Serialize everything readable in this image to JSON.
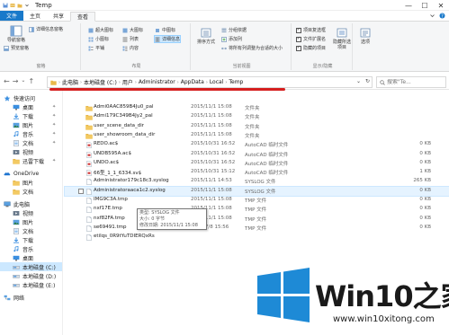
{
  "window": {
    "title": "Temp",
    "controls": {
      "minimize": "—",
      "maximize": "☐",
      "close": "✕"
    }
  },
  "tabs": [
    {
      "label": "文件"
    },
    {
      "label": "主页"
    },
    {
      "label": "共享"
    },
    {
      "label": "查看"
    }
  ],
  "tab_right_icons": [
    "chevron-down-icon",
    "help-icon"
  ],
  "ribbon": {
    "pane": {
      "nav_pane": "导航窗格",
      "preview_pane": "预览窗格",
      "details_pane": "详细信息窗格",
      "group_label": "窗格"
    },
    "layout": {
      "items": [
        "超大图标",
        "大图标",
        "中图标",
        "小图标",
        "列表",
        "详细信息",
        "平铺",
        "内容"
      ],
      "selected": "详细信息",
      "group_label": "布局"
    },
    "current_view": {
      "sort_by": "排序方式",
      "group_by": "分组依据",
      "add_columns": "添加列",
      "size_all_columns": "将所有列调整为合适的大小",
      "group_label": "当前视图"
    },
    "show_hide": {
      "item_checkboxes": {
        "label": "项目复选框",
        "checked": true
      },
      "file_extensions": {
        "label": "文件扩展名",
        "checked": true
      },
      "hidden_items": {
        "label": "隐藏的项目",
        "checked": true
      },
      "hide_selected": "隐藏所选项目",
      "group_label": "显示/隐藏"
    },
    "options": {
      "label": "选项"
    }
  },
  "address": {
    "back": "←",
    "forward": "→",
    "recent": "⌄",
    "up": "↑",
    "crumbs": [
      "此电脑",
      "本地磁盘 (C:)",
      "用户",
      "Administrator",
      "AppData",
      "Local",
      "Temp"
    ],
    "dropdown": "⌄",
    "refresh": "↻",
    "search_placeholder": "搜索\"Te..."
  },
  "sidebar": {
    "items": [
      {
        "label": "快速访问",
        "icon": "star-icon",
        "pinned": false
      },
      {
        "label": "桌面",
        "icon": "desktop-icon",
        "pinned": true
      },
      {
        "label": "下载",
        "icon": "download-icon",
        "pinned": true
      },
      {
        "label": "图片",
        "icon": "pictures-icon",
        "pinned": true
      },
      {
        "label": "音乐",
        "icon": "music-icon",
        "pinned": true
      },
      {
        "label": "文档",
        "icon": "documents-icon",
        "pinned": true
      },
      {
        "label": "视频",
        "icon": "video-icon",
        "pinned": false
      },
      {
        "label": "迅雷下载",
        "icon": "folder-icon",
        "pinned": true
      },
      {
        "label": "OneDrive",
        "icon": "onedrive-icon",
        "pinned": false
      },
      {
        "label": "图片",
        "icon": "folder-icon",
        "pinned": false
      },
      {
        "label": "文档",
        "icon": "folder-icon",
        "pinned": false
      },
      {
        "label": "此电脑",
        "icon": "pc-icon",
        "pinned": false
      },
      {
        "label": "视频",
        "icon": "video-icon",
        "pinned": false
      },
      {
        "label": "图片",
        "icon": "pictures-icon",
        "pinned": false
      },
      {
        "label": "文档",
        "icon": "documents-icon",
        "pinned": false
      },
      {
        "label": "下载",
        "icon": "download-icon",
        "pinned": false
      },
      {
        "label": "音乐",
        "icon": "music-icon",
        "pinned": false
      },
      {
        "label": "桌面",
        "icon": "desktop-icon",
        "pinned": false
      },
      {
        "label": "本地磁盘 (C:)",
        "icon": "drive-icon",
        "pinned": false,
        "selected": true
      },
      {
        "label": "本地磁盘 (D:)",
        "icon": "drive-icon",
        "pinned": false
      },
      {
        "label": "本地磁盘 (E:)",
        "icon": "drive-icon",
        "pinned": false
      },
      {
        "label": "网络",
        "icon": "network-icon",
        "pinned": false
      }
    ]
  },
  "files": [
    {
      "name": "Admi0AAC859B4Ju0_pal",
      "date": "2015/11/1 15:08",
      "type": "文件夹",
      "size": "",
      "icon": "folder-icon"
    },
    {
      "name": "Admi179C349B4Jy2_pal",
      "date": "2015/11/1 15:08",
      "type": "文件夹",
      "size": "",
      "icon": "folder-icon"
    },
    {
      "name": "user_scene_data_dir",
      "date": "2015/11/1 15:08",
      "type": "文件夹",
      "size": "",
      "icon": "folder-icon"
    },
    {
      "name": "user_showroom_data_dir",
      "date": "2015/11/1 15:08",
      "type": "文件夹",
      "size": "",
      "icon": "folder-icon"
    },
    {
      "name": "REDO.ac$",
      "date": "2015/10/31 16:52",
      "type": "AutoCAD 临时文件",
      "size": "0 KB",
      "icon": "autocad-file-icon"
    },
    {
      "name": "UNDB595A.ac$",
      "date": "2015/10/31 16:52",
      "type": "AutoCAD 临时文件",
      "size": "0 KB",
      "icon": "autocad-file-icon"
    },
    {
      "name": "UNDO.ac$",
      "date": "2015/10/31 16:52",
      "type": "AutoCAD 临时文件",
      "size": "0 KB",
      "icon": "autocad-file-icon"
    },
    {
      "name": "66型_1_1_6334.sv$",
      "date": "2015/10/31 15:12",
      "type": "AutoCAD 临时文件",
      "size": "1 KB",
      "icon": "autocad-file-icon"
    },
    {
      "name": "Administrator179c18c3.syslog",
      "date": "2015/11/1 14:53",
      "type": "SYSLOG 文件",
      "size": "265 KB",
      "icon": "file-icon"
    },
    {
      "name": "Administratoraaca1c2.syslog",
      "date": "2015/11/1 15:08",
      "type": "SYSLOG 文件",
      "size": "0 KB",
      "icon": "file-icon",
      "hover": true
    },
    {
      "name": "IMG9C3A.tmp",
      "date": "2015/11/1 15:08",
      "type": "TMP 文件",
      "size": "0 KB",
      "icon": "file-icon"
    },
    {
      "name": "nxf17E.tmp",
      "date": "2015/11/1 15:08",
      "type": "TMP 文件",
      "size": "0 KB",
      "icon": "file-icon"
    },
    {
      "name": "nxf82FA.tmp",
      "date": "2015/11/1 15:08",
      "type": "TMP 文件",
      "size": "0 KB",
      "icon": "file-icon"
    },
    {
      "name": "se69491.tmp",
      "date": "2015/7/8 15:56",
      "type": "TMP 文件",
      "size": "0 KB",
      "icon": "file-icon"
    },
    {
      "name": "etilqs_0R9tYuTDIERQxRs",
      "date": "",
      "type": "",
      "size": "",
      "icon": "file-icon"
    }
  ],
  "tooltip": {
    "type": "类型: SYSLOG 文件",
    "size": "大小: 0 字节",
    "modified": "修改日期: 2015/11/1 15:08"
  },
  "watermark": {
    "brand": "Win10之家",
    "url": "www.win10xitong.com",
    "colors": {
      "blue": "#1e8ad6",
      "dark": "#1a1a1a"
    }
  },
  "colors": {
    "accent": "#1979ca",
    "folder": "#e8b84a",
    "selection": "#cce8ff",
    "annotation_red": "#d51e1e"
  }
}
